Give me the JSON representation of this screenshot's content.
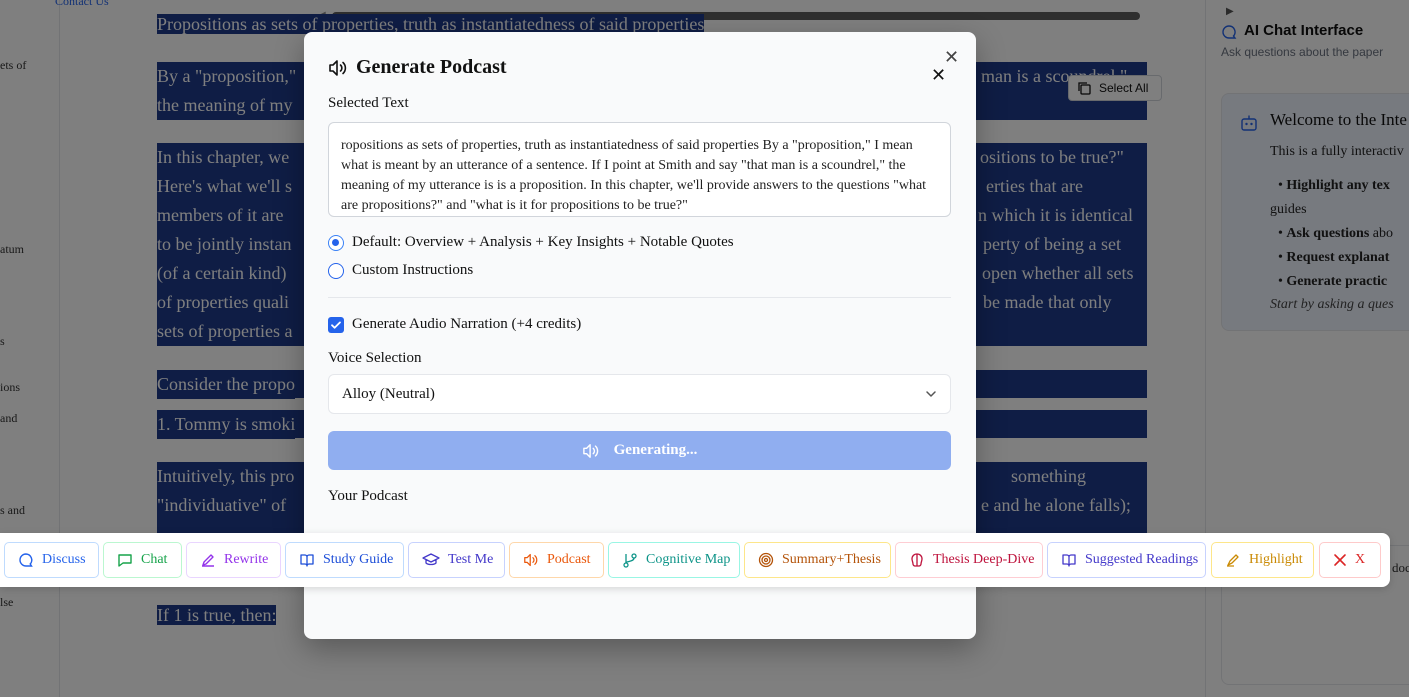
{
  "left_sidebar": {
    "items": [
      "ets of",
      "atum",
      "s",
      "ions",
      "and",
      "s and",
      "lse"
    ]
  },
  "contact_link": "Contact Us",
  "document": {
    "line1": "Propositions as sets of properties, truth as instantiatedness of said properties",
    "p1a": "By a \"proposition,\"",
    "p1a_end": "man is a scoundrel,\"",
    "p1b": "the meaning of my",
    "p2a": "In this chapter, we",
    "p2a_end": "ositions to be true?\"",
    "p2b": "Here's what we'll s",
    "p2b_end": "erties that are",
    "p2c": "members of it are",
    "p2c_end": "n which it is identical",
    "p2d": "to be jointly instan",
    "p2d_end": "perty of being a set",
    "p2e": "(of a certain kind)",
    "p2e_end": "open whether all sets",
    "p2f": "of properties quali",
    "p2f_end": "be made that only",
    "p2g": "sets of properties a",
    "p3": "Consider the propo",
    "p4": "1. Tommy is smoki",
    "p5a": "Intuitively, this pro",
    "p5a_end": "something",
    "p5b": "\"individuative\" of",
    "p5b_end": "e and he alone falls);",
    "p6": "If 1 is true, then:"
  },
  "select_all_label": "Select All",
  "chat_panel": {
    "title": "AI Chat Interface",
    "subtitle": "Ask questions about the paper",
    "welcome": "Welcome to the Inte",
    "desc": "This is a fully interactiv",
    "bullets": [
      {
        "bold": "Highlight any tex",
        "rest": ""
      },
      {
        "bold": "",
        "rest": "guides"
      },
      {
        "bold": "Ask questions",
        "rest": " abo"
      },
      {
        "bold": "Request explanat",
        "rest": ""
      },
      {
        "bold": "Generate practic",
        "rest": ""
      }
    ],
    "start_hint": "Start by asking a ques",
    "bottom_card_text": "doc"
  },
  "modal": {
    "title": "Generate Podcast",
    "selected_text_label": "Selected Text",
    "selected_text": "ropositions as sets of properties, truth as instantiatedness of said properties By a \"proposition,\" I mean what is meant by an utterance of a sentence. If I point at Smith and say \"that man is a scoundrel,\" the meaning of my utterance is is a proposition. In this chapter, we'll provide answers to the questions \"what are propositions?\" and \"what is it for propositions to be true?\"",
    "option_default": "Default: Overview + Analysis + Key Insights + Notable Quotes",
    "option_custom": "Custom Instructions",
    "audio_label": "Generate Audio Narration (+4 credits)",
    "voice_label": "Voice Selection",
    "voice_value": "Alloy (Neutral)",
    "generate_label": "Generating...",
    "your_podcast_label": "Your Podcast"
  },
  "toolbar": {
    "discuss": "Discuss",
    "chat": "Chat",
    "rewrite": "Rewrite",
    "study_guide": "Study Guide",
    "test_me": "Test Me",
    "podcast": "Podcast",
    "cognitive_map": "Cognitive Map",
    "summary_thesis": "Summary+Thesis",
    "thesis_deep_dive": "Thesis Deep-Dive",
    "suggested_readings": "Suggested Readings",
    "highlight": "Highlight",
    "close": "X"
  },
  "colors": {
    "highlight": "#1e3a8a",
    "primary": "#2563eb",
    "generate_disabled": "#90aef0"
  }
}
